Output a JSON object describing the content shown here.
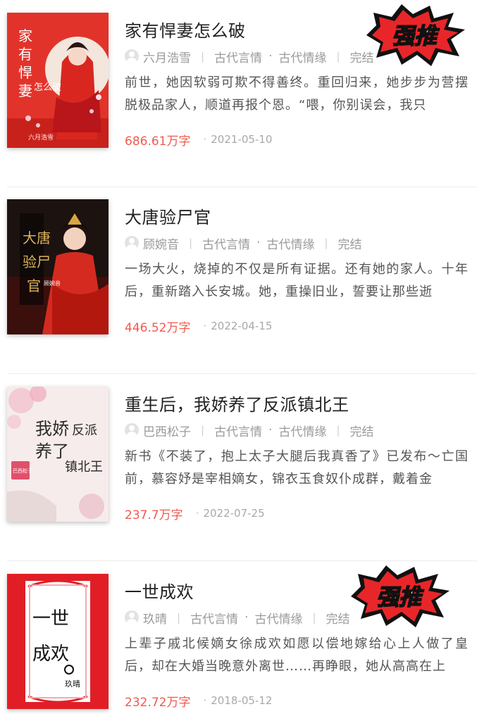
{
  "books": [
    {
      "title": "家有悍妻怎么破",
      "author": "六月浩雪",
      "category": "古代言情",
      "subcategory": "古代情缘",
      "status": "完结",
      "description": "前世，她因软弱可欺不得善终。重回归来，她步步为营摆脱极品家人，顺道再报个恩。“喂，你别误会，我只",
      "word_count": "686.61万字",
      "date": "2021-05-10",
      "badge": "强推",
      "cover_text": [
        "家",
        "有",
        "悍",
        "妻",
        "怎么破"
      ],
      "cover_author": "六月浩雪"
    },
    {
      "title": "大唐验尸官",
      "author": "顾婉音",
      "category": "古代言情",
      "subcategory": "古代情缘",
      "status": "完结",
      "description": "一场大火，烧掉的不仅是所有证据。还有她的家人。十年后，重新踏入长安城。她，重操旧业，誓要让那些逝",
      "word_count": "446.52万字",
      "date": "2022-04-15",
      "badge": "",
      "cover_text": [
        "大唐",
        "验尸",
        "官"
      ],
      "cover_author": "顾婉音"
    },
    {
      "title": "重生后，我娇养了反派镇北王",
      "author": "巴西松子",
      "category": "古代言情",
      "subcategory": "古代情缘",
      "status": "完结",
      "description": "新书《不装了，抱上太子大腿后我真香了》已发布～亡国前，慕容妤是宰相嫡女，锦衣玉食奴仆成群，戴着金",
      "word_count": "237.7万字",
      "date": "2022-07-25",
      "badge": "",
      "cover_text": [
        "我娇",
        "养了",
        "反派",
        "镇北王"
      ],
      "cover_author": "巴西松子"
    },
    {
      "title": "一世成欢",
      "author": "玖晴",
      "category": "古代言情",
      "subcategory": "古代情缘",
      "status": "完结",
      "description": "上辈子戚北候嫡女徐成欢如愿以偿地嫁给心上人做了皇后，却在大婚当晚意外离世……再睁眼，她从高高在上",
      "word_count": "232.72万字",
      "date": "2018-05-12",
      "badge": "强推",
      "cover_text": [
        "一世",
        "成欢"
      ],
      "cover_author": "玖晴"
    }
  ],
  "colors": {
    "accent": "#f25a4e",
    "badge_red": "#e8262a",
    "title": "#222222",
    "meta": "#9a9a9a"
  }
}
